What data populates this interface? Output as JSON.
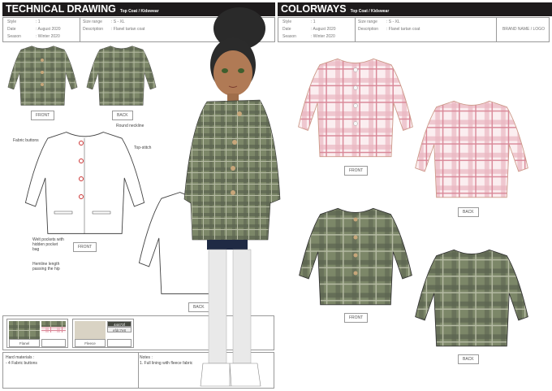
{
  "left": {
    "title": "TECHNICAL DRAWING",
    "subtitle": "Top Coat / Kidswear",
    "info": {
      "style_label": "Style",
      "style": ": 1",
      "date_label": "Date",
      "date": ": August 2020",
      "season_label": "Season",
      "season": ": Winter 2020",
      "size_label": "Size range",
      "size": ": S - XL",
      "desc_label": "Description",
      "desc": ": Flanel tartan coat"
    },
    "labels": {
      "front1": "FRONT",
      "back1": "BACK",
      "front2": "FRONT",
      "back2": "BACK"
    },
    "callouts": {
      "buttons": "Fabric buttons",
      "neck": "Round neckline",
      "topstitch": "Top-stitch",
      "pockets": "Welt pockets with hidden pocket bag",
      "hem": "Hemline length passing the hip"
    },
    "swatches": {
      "flannel": "Flanel",
      "fleece": "Fleece",
      "color1": "44473f",
      "color2": "efdc7e8"
    },
    "notes": {
      "hard_label": "Hard materials    :",
      "hard_item": "- 4 Fabric buttons",
      "notes_label": "Notes      :",
      "notes_item": "1. Full lining with fleece fabric"
    }
  },
  "right": {
    "title": "COLORWAYS",
    "subtitle": "Top Coat / Kidswear",
    "info": {
      "style_label": "Style",
      "style": ": 1",
      "date_label": "Date",
      "date": ": August 2020",
      "season_label": "Season",
      "season": ": Winter 2020",
      "size_label": "Size range",
      "size": ": S - XL",
      "desc_label": "Description",
      "desc": ": Flanel tartan coat",
      "brand": "BRAND NAME / LOGO"
    },
    "labels": {
      "front1": "FRONT",
      "back1": "BACK",
      "front2": "FRONT",
      "back2": "BACK"
    }
  },
  "colors": {
    "green": "#6f7a5c",
    "pink": "#f3cfd6",
    "dark": "#1e1b1c"
  }
}
